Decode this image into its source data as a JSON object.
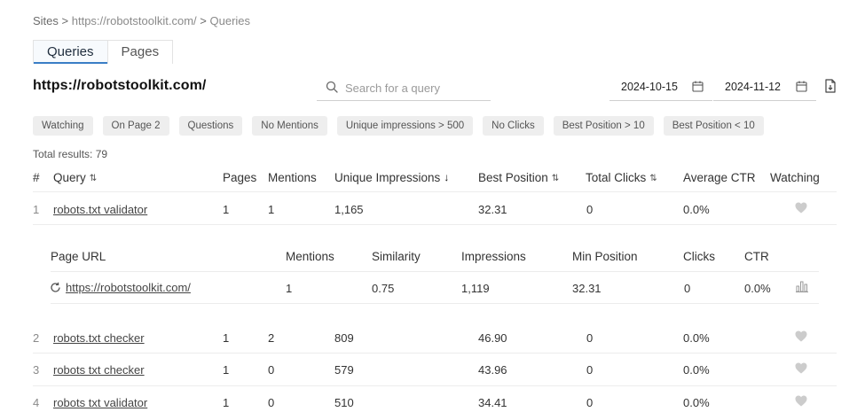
{
  "breadcrumb": {
    "sites": "Sites",
    "sep1": ">",
    "site": "https://robotstoolkit.com/",
    "sep2": ">",
    "current": "Queries"
  },
  "tabs": [
    {
      "label": "Queries",
      "active": true
    },
    {
      "label": "Pages",
      "active": false
    }
  ],
  "site_title": "https://robotstoolkit.com/",
  "search": {
    "placeholder": "Search for a query",
    "value": ""
  },
  "date_range": {
    "start": "2024-10-15",
    "end": "2024-11-12"
  },
  "filters": [
    "Watching",
    "On Page 2",
    "Questions",
    "No Mentions",
    "Unique impressions > 500",
    "No Clicks",
    "Best Position > 10",
    "Best Position < 10"
  ],
  "total_results": "Total results: 79",
  "table": {
    "headers": {
      "num": "#",
      "query": "Query",
      "pages": "Pages",
      "mentions": "Mentions",
      "unique_impressions": "Unique Impressions",
      "best_position": "Best Position",
      "total_clicks": "Total Clicks",
      "average_ctr": "Average CTR",
      "watching": "Watching"
    },
    "sort": {
      "query": "⇅",
      "unique_impressions": "↓",
      "best_position": "⇅",
      "total_clicks": "⇅"
    },
    "rows": [
      {
        "num": "1",
        "query": "robots.txt validator",
        "pages": "1",
        "mentions": "1",
        "unique_impressions": "1,165",
        "best_position": "32.31",
        "total_clicks": "0",
        "average_ctr": "0.0%"
      },
      {
        "num": "2",
        "query": "robots.txt checker",
        "pages": "1",
        "mentions": "2",
        "unique_impressions": "809",
        "best_position": "46.90",
        "total_clicks": "0",
        "average_ctr": "0.0%"
      },
      {
        "num": "3",
        "query": "robots txt checker",
        "pages": "1",
        "mentions": "0",
        "unique_impressions": "579",
        "best_position": "43.96",
        "total_clicks": "0",
        "average_ctr": "0.0%"
      },
      {
        "num": "4",
        "query": "robots txt validator",
        "pages": "1",
        "mentions": "0",
        "unique_impressions": "510",
        "best_position": "34.41",
        "total_clicks": "0",
        "average_ctr": "0.0%"
      }
    ]
  },
  "subtable": {
    "headers": {
      "page_url": "Page URL",
      "mentions": "Mentions",
      "similarity": "Similarity",
      "impressions": "Impressions",
      "min_position": "Min Position",
      "clicks": "Clicks",
      "ctr": "CTR"
    },
    "rows": [
      {
        "page_url": "https://robotstoolkit.com/",
        "mentions": "1",
        "similarity": "0.75",
        "impressions": "1,119",
        "min_position": "32.31",
        "clicks": "0",
        "ctr": "0.0%"
      }
    ]
  },
  "colors": {
    "accent": "#3a7ec6",
    "chip_bg": "#eeeeee",
    "heart": "#cccccc"
  }
}
